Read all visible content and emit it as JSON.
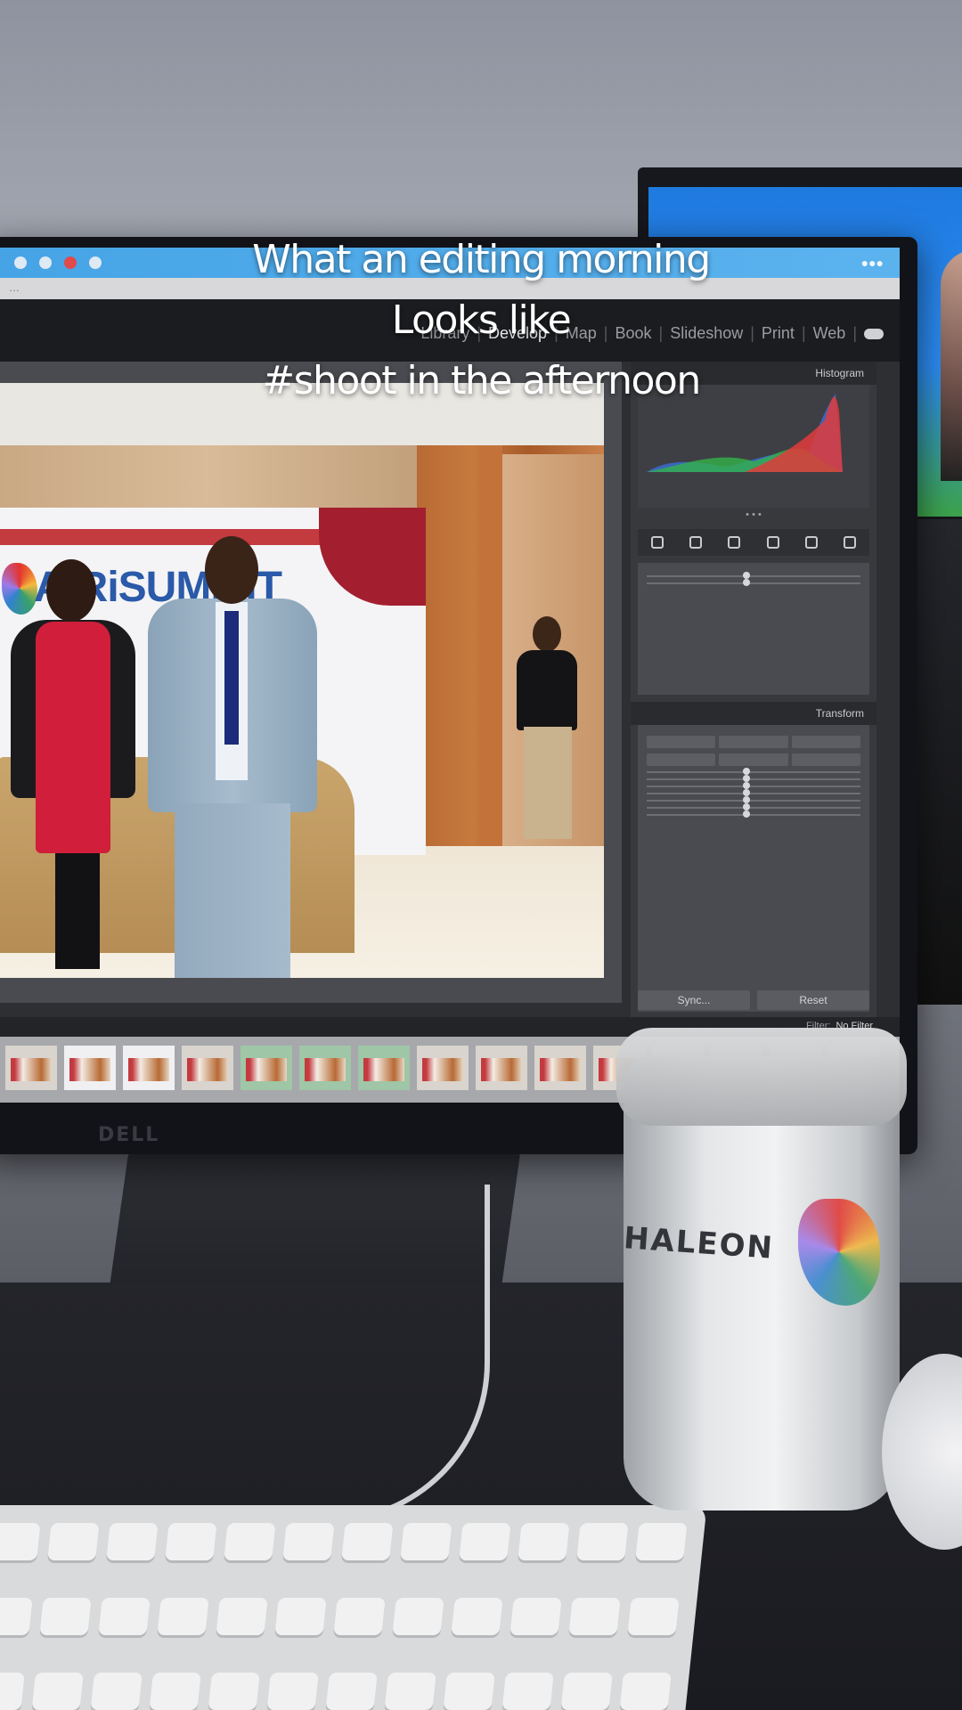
{
  "caption": {
    "line1": "What an editing morning",
    "line2": "Looks like",
    "line3": "#shoot in the afternoon"
  },
  "lightroom": {
    "modules": [
      "Library",
      "Develop",
      "Map",
      "Book",
      "Slideshow",
      "Print",
      "Web"
    ],
    "active_module": "Develop",
    "panel": {
      "histogram_title": "Histogram",
      "transform_title": "Transform",
      "sync_label": "Sync...",
      "reset_label": "Reset"
    },
    "filmstrip": {
      "filter_label": "Filter:",
      "filter_value": "No Filter"
    }
  },
  "banner_text": "AfRiSUMMIT",
  "monitor_brand": "DELL",
  "mug_text": "HALEON",
  "colors": {
    "menubar": "#46a4e6",
    "caption_text": "#ffffff",
    "lightroom_panel": "#38393d"
  }
}
